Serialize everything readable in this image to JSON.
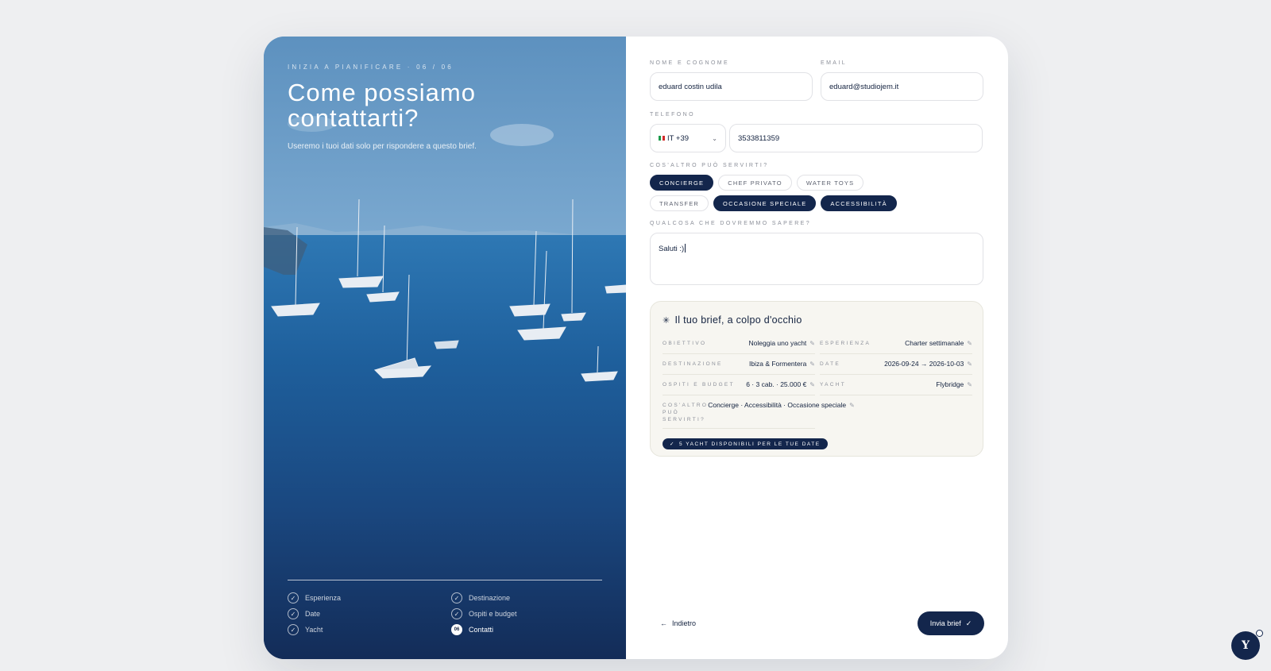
{
  "hero": {
    "eyebrow": "INIZIA A PIANIFICARE · 06 / 06",
    "title": "Come possiamo contattarti?",
    "subtitle": "Useremo i tuoi dati solo per rispondere a questo brief."
  },
  "steps": [
    {
      "label": "Esperienza",
      "state": "done"
    },
    {
      "label": "Destinazione",
      "state": "done"
    },
    {
      "label": "Date",
      "state": "done"
    },
    {
      "label": "Ospiti e budget",
      "state": "done"
    },
    {
      "label": "Yacht",
      "state": "done"
    },
    {
      "label": "Contatti",
      "state": "active",
      "badge": "06"
    }
  ],
  "form": {
    "name_label": "NOME E COGNOME",
    "name_value": "eduard costin udila",
    "email_label": "EMAIL",
    "email_value": "eduard@studiojem.it",
    "phone_label": "TELEFONO",
    "country_code": "IT +39",
    "phone_value": "3533811359",
    "extras_label": "COS'ALTRO PUÒ SERVIRTI?",
    "extras": [
      {
        "label": "CONCIERGE",
        "selected": true
      },
      {
        "label": "CHEF PRIVATO",
        "selected": false
      },
      {
        "label": "WATER TOYS",
        "selected": false
      },
      {
        "label": "TRANSFER",
        "selected": false
      },
      {
        "label": "OCCASIONE SPECIALE",
        "selected": true
      },
      {
        "label": "ACCESSIBILITÀ",
        "selected": true
      }
    ],
    "notes_label": "QUALCOSA CHE DOVREMMO SAPERE?",
    "notes_value": "Saluti :)"
  },
  "brief": {
    "title": "Il tuo brief, a colpo d'occhio",
    "rows": [
      {
        "key": "OBIETTIVO",
        "value": "Noleggia uno yacht"
      },
      {
        "key": "ESPERIENZA",
        "value": "Charter settimanale"
      },
      {
        "key": "DESTINAZIONE",
        "value": "Ibiza & Formentera"
      },
      {
        "key": "DATE",
        "value": "2026-09-24 → 2026-10-03"
      },
      {
        "key": "OSPITI E BUDGET",
        "value": "6 · 3 cab. · 25.000 €"
      },
      {
        "key": "YACHT",
        "value": "Flybridge"
      }
    ],
    "extras_key": "COS'ALTRO PUÒ SERVIRTI?",
    "extras_value": "Concierge · Accessibilità · Occasione speciale",
    "availability": "5 YACHT DISPONIBILI PER LE TUE DATE"
  },
  "nav": {
    "back_label": "Indietro",
    "submit_label": "Invia brief"
  },
  "colors": {
    "navy": "#13264c",
    "background": "#eeeff1",
    "brief_bg": "#f7f6f1"
  }
}
